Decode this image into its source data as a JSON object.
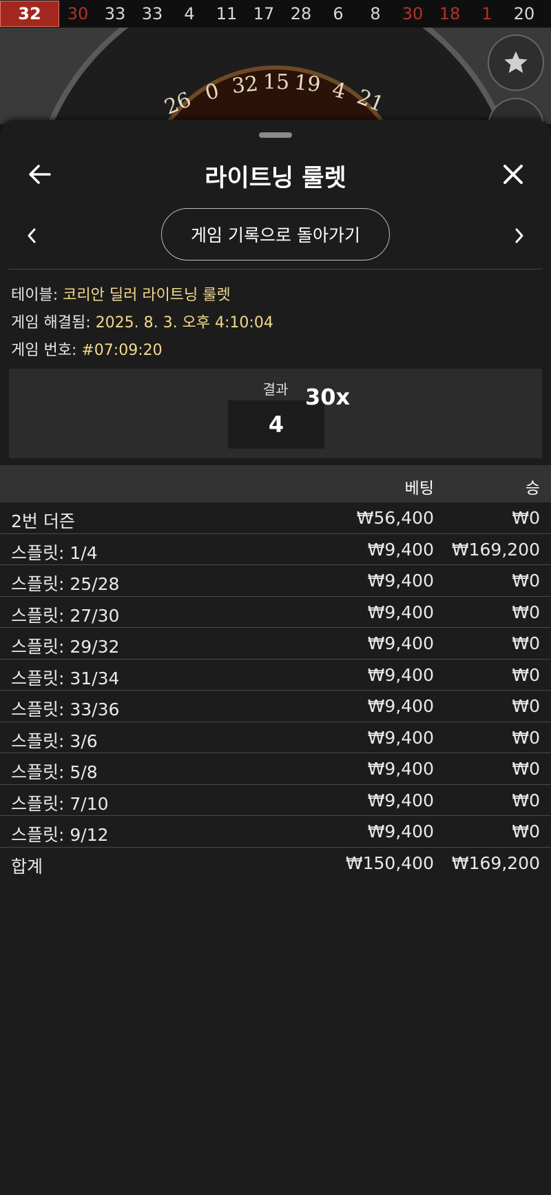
{
  "history": {
    "numbers": [
      {
        "value": "32",
        "color": "red"
      },
      {
        "value": "30",
        "color": "red"
      },
      {
        "value": "33",
        "color": "black"
      },
      {
        "value": "33",
        "color": "black"
      },
      {
        "value": "4",
        "color": "black"
      },
      {
        "value": "11",
        "color": "black"
      },
      {
        "value": "17",
        "color": "black"
      },
      {
        "value": "28",
        "color": "black"
      },
      {
        "value": "6",
        "color": "black"
      },
      {
        "value": "8",
        "color": "black"
      },
      {
        "value": "30",
        "color": "red"
      },
      {
        "value": "18",
        "color": "red"
      },
      {
        "value": "1",
        "color": "red"
      },
      {
        "value": "20",
        "color": "black"
      }
    ]
  },
  "wheel": {
    "numbers": [
      "26",
      "0",
      "32",
      "15",
      "19",
      "4",
      "21"
    ]
  },
  "header": {
    "title": "라이트닝 룰렛"
  },
  "nav": {
    "history_button": "게임 기록으로 돌아가기"
  },
  "info": {
    "table_label": "테이블:",
    "table_value": "코리안 딜러 라이트닝 룰렛",
    "resolved_label": "게임 해결됨:",
    "resolved_value": "2025. 8. 3. 오후 4:10:04",
    "game_no_label": "게임 번호:",
    "game_no_value": "#07:09:20"
  },
  "result": {
    "label": "결과",
    "number": "4",
    "multiplier": "30x"
  },
  "table": {
    "col_bet": "베팅",
    "col_win": "승",
    "rows": [
      {
        "name": "2번 더즌",
        "bet": "₩56,400",
        "win": "₩0"
      },
      {
        "name": "스플릿: 1/4",
        "bet": "₩9,400",
        "win": "₩169,200"
      },
      {
        "name": "스플릿: 25/28",
        "bet": "₩9,400",
        "win": "₩0"
      },
      {
        "name": "스플릿: 27/30",
        "bet": "₩9,400",
        "win": "₩0"
      },
      {
        "name": "스플릿: 29/32",
        "bet": "₩9,400",
        "win": "₩0"
      },
      {
        "name": "스플릿: 31/34",
        "bet": "₩9,400",
        "win": "₩0"
      },
      {
        "name": "스플릿: 33/36",
        "bet": "₩9,400",
        "win": "₩0"
      },
      {
        "name": "스플릿: 3/6",
        "bet": "₩9,400",
        "win": "₩0"
      },
      {
        "name": "스플릿: 5/8",
        "bet": "₩9,400",
        "win": "₩0"
      },
      {
        "name": "스플릿: 7/10",
        "bet": "₩9,400",
        "win": "₩0"
      },
      {
        "name": "스플릿: 9/12",
        "bet": "₩9,400",
        "win": "₩0"
      }
    ],
    "total": {
      "name": "합계",
      "bet": "₩150,400",
      "win": "₩169,200"
    }
  },
  "icons": {
    "back": "arrow-left-icon",
    "close": "close-icon",
    "prev": "chevron-left-icon",
    "next": "chevron-right-icon",
    "favorite": "star-icon"
  },
  "colors": {
    "accent_value": "#f3d98a",
    "red_number": "#b3322a",
    "latest_number_bg": "#a3271f"
  }
}
